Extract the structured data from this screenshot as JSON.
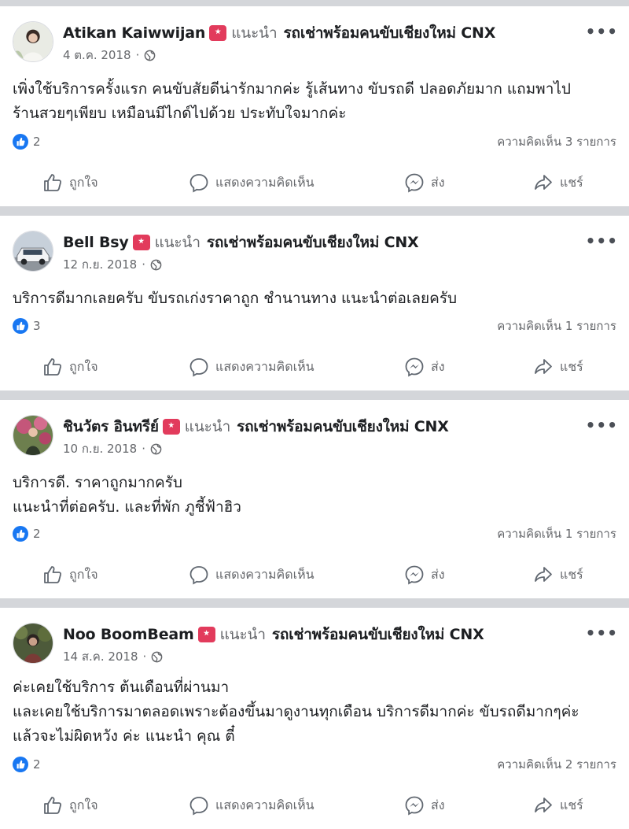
{
  "verb": "แนะนำ",
  "page_name": "รถเช่าพร้อมคนขับเชียงใหม่ CNX",
  "actions": {
    "like": "ถูกใจ",
    "comment": "แสดงความคิดเห็น",
    "send": "ส่ง",
    "share": "แชร์"
  },
  "icons": {
    "avatar": "avatar",
    "recommend": "recommend-badge-icon",
    "globe": "globe-icon",
    "more": "more-options-icon",
    "reaction": "like-reaction-icon",
    "like": "thumb-up-icon",
    "comment": "comment-bubble-icon",
    "send": "messenger-icon",
    "share": "share-arrow-icon"
  },
  "colors": {
    "reaction_blue": "#1877f2",
    "recommend_red": "#e23b5c",
    "divider": "#d4d6da",
    "secondary_text": "#65676b"
  },
  "posts": [
    {
      "author": "Atikan Kaiwwijan",
      "date": "4 ต.ค. 2018",
      "body": [
        "เพิ่งใช้บริการครั้งแรก คนขับสัยดีน่ารักมากค่ะ รู้เส้นทาง ขับรถดี ปลอดภัยมาก แถมพาไป",
        "ร้านสวยๆเพียบ เหมือนมีไกด์ไปด้วย ประทับใจมากค่ะ"
      ],
      "likes": "2",
      "comments": "ความคิดเห็น 3 รายการ"
    },
    {
      "author": "Bell Bsy",
      "date": "12 ก.ย. 2018",
      "body": [
        "บริการดีมากเลยครับ ขับรถเก่งราคาถูก ชำนานทาง แนะนำต่อเลยครับ"
      ],
      "likes": "3",
      "comments": "ความคิดเห็น 1 รายการ"
    },
    {
      "author": "ชินวัตร อินทรีย์",
      "date": "10 ก.ย. 2018",
      "body": [
        "บริการดี. ราคาถูกมากครับ",
        "แนะนำที่ต่อครับ. และที่พัก ภูชี้ฟ้าฮิว"
      ],
      "likes": "2",
      "comments": "ความคิดเห็น 1 รายการ"
    },
    {
      "author": "Noo BoomBeam",
      "date": "14 ส.ค. 2018",
      "body": [
        "ค่ะเคยใช้บริการ ต้นเดือนที่ผ่านมา",
        "และเคยใช้บริการมาตลอดเพราะต้องขึ้นมาดูงานทุกเดือน บริการดีมากค่ะ ขับรถดีมากๆค่ะ",
        "แล้วจะไม่ผิดหวัง ค่ะ แนะนำ คุณ ตี๋"
      ],
      "likes": "2",
      "comments": "ความคิดเห็น 2 รายการ"
    }
  ]
}
